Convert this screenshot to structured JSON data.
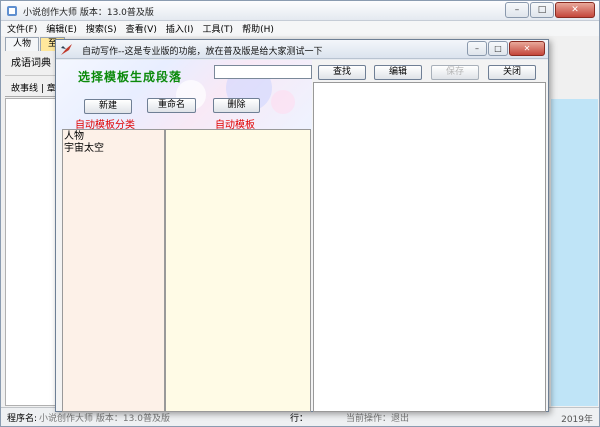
{
  "main": {
    "title": "小说创作大师 版本：13.0普及版",
    "menu": [
      "文件(F)",
      "编辑(E)",
      "搜索(S)",
      "查看(V)",
      "插入(I)",
      "工具(T)",
      "帮助(H)"
    ],
    "tabs": [
      "人物",
      "至"
    ],
    "tool_label": "成语词典",
    "story_tabs": "故事线 | 章",
    "status": {
      "program_label": "程序名:",
      "program_value": "小说创作大师 版本：13.0普及版",
      "row_label": "行：",
      "op_label": "当前操作：退出",
      "year": "2019年"
    }
  },
  "dialog": {
    "title": "自动写作--这是专业版的功能，放在普及版是给大家测试一下",
    "heading": "选择模板生成段落",
    "search": {
      "value": "",
      "placeholder": ""
    },
    "buttons": {
      "find": "查找",
      "edit": "编辑",
      "disabled": "保存",
      "close": "关闭",
      "new": "新建",
      "rename": "重命名",
      "delete": "删除"
    },
    "labels": {
      "categories": "自动模板分类",
      "templates": "自动模板"
    },
    "categories": [
      "人物",
      "宇宙太空"
    ]
  },
  "colors": {
    "heading": "#0b8a0b",
    "labels": "#e00000",
    "category_bg": "#fdf1e8",
    "template_bg": "#fffbe6",
    "side_strip": "#bfe4f7",
    "active_tab": "#ffe89c"
  },
  "icons": {
    "app": "app-icon",
    "dialog": "quill-icon",
    "minimize": "minimize-icon",
    "maximize": "maximize-icon",
    "close": "close-icon"
  }
}
